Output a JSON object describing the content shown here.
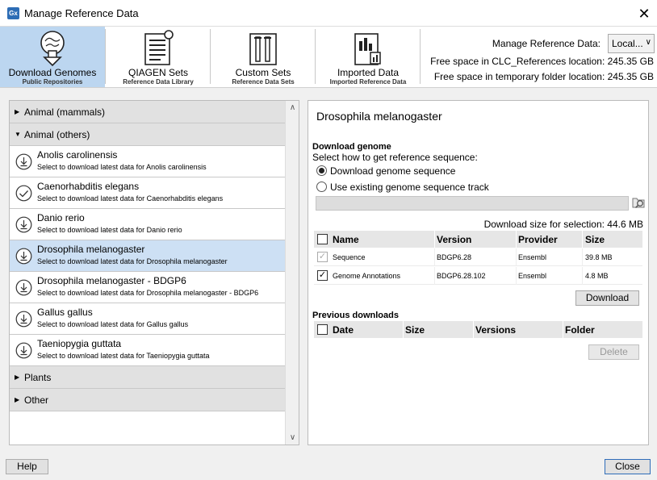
{
  "window": {
    "title": "Manage Reference Data",
    "app_icon": "Gx"
  },
  "toolbar": {
    "buttons": [
      {
        "label": "Download Genomes",
        "sub": "Public Repositories"
      },
      {
        "label": "QIAGEN Sets",
        "sub": "Reference Data Library"
      },
      {
        "label": "Custom Sets",
        "sub": "Reference Data Sets"
      },
      {
        "label": "Imported Data",
        "sub": "Imported Reference Data"
      }
    ],
    "manage_label": "Manage Reference Data:",
    "manage_value": "Local...",
    "free_space_refs": "Free space in CLC_References location: 245.35 GB",
    "free_space_tmp": "Free space in temporary folder location: 245.35 GB"
  },
  "left": {
    "groups": {
      "mammals": "Animal (mammals)",
      "others": "Animal (others)",
      "plants": "Plants",
      "other": "Other"
    },
    "items": [
      {
        "name": "Anolis carolinensis",
        "desc": "Select to download latest data for Anolis carolinensis",
        "icon": "download-icon"
      },
      {
        "name": "Caenorhabditis elegans",
        "desc": "Select to download latest data for Caenorhabditis elegans",
        "icon": "check-circle-icon"
      },
      {
        "name": "Danio rerio",
        "desc": "Select to download latest data for Danio rerio",
        "icon": "download-icon"
      },
      {
        "name": "Drosophila melanogaster",
        "desc": "Select to download latest data for Drosophila melanogaster",
        "icon": "download-icon"
      },
      {
        "name": "Drosophila melanogaster - BDGP6",
        "desc": "Select to download latest data for Drosophila melanogaster - BDGP6",
        "icon": "download-icon"
      },
      {
        "name": "Gallus gallus",
        "desc": "Select to download latest data for Gallus gallus",
        "icon": "download-icon"
      },
      {
        "name": "Taeniopygia guttata",
        "desc": "Select to download latest data for Taeniopygia guttata",
        "icon": "download-icon"
      }
    ]
  },
  "right": {
    "title": "Drosophila melanogaster",
    "download_genome_heading": "Download genome",
    "select_how": "Select how to get reference sequence:",
    "opt_download": "Download genome sequence",
    "opt_existing": "Use existing genome sequence track",
    "download_size": "Download size for selection: 44.6 MB",
    "table_headers": {
      "name": "Name",
      "version": "Version",
      "provider": "Provider",
      "size": "Size"
    },
    "rows": [
      {
        "name": "Sequence",
        "version": "BDGP6.28",
        "provider": "Ensembl",
        "size": "39.8 MB"
      },
      {
        "name": "Genome Annotations",
        "version": "BDGP6.28.102",
        "provider": "Ensembl",
        "size": "4.8 MB"
      }
    ],
    "download_button": "Download",
    "previous_heading": "Previous downloads",
    "prev_headers": {
      "date": "Date",
      "size": "Size",
      "versions": "Versions",
      "folder": "Folder"
    },
    "delete_button": "Delete"
  },
  "footer": {
    "help": "Help",
    "close": "Close"
  }
}
